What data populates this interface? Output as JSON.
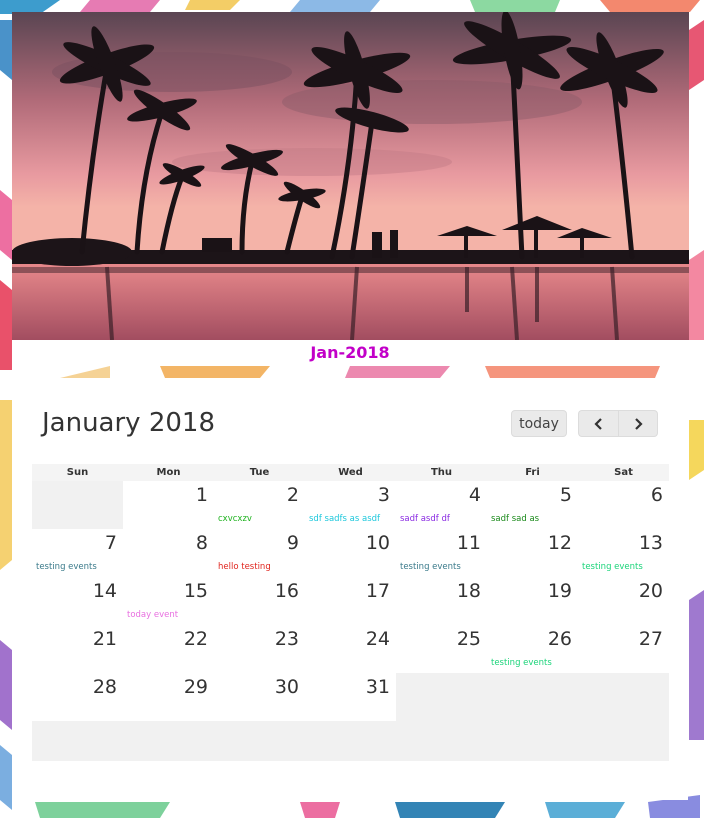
{
  "caption": "Jan-2018",
  "calendar": {
    "title": "January 2018",
    "today_label": "today",
    "prev_icon": "chevron-left-icon",
    "next_icon": "chevron-right-icon",
    "weekdays": [
      "Sun",
      "Mon",
      "Tue",
      "Wed",
      "Thu",
      "Fri",
      "Sat"
    ],
    "weeks": [
      [
        {
          "day": "",
          "other": true,
          "event": "",
          "color": ""
        },
        {
          "day": "1",
          "event": "",
          "color": ""
        },
        {
          "day": "2",
          "event": "cxvcxzv",
          "color": "#1fb31f"
        },
        {
          "day": "3",
          "event": "sdf sadfs as asdf",
          "color": "#1ec8dc"
        },
        {
          "day": "4",
          "event": "sadf asdf df",
          "color": "#8a2be2"
        },
        {
          "day": "5",
          "event": "sadf sad as",
          "color": "#1b8a1b"
        },
        {
          "day": "6",
          "event": "",
          "color": ""
        }
      ],
      [
        {
          "day": "7",
          "event": "testing events",
          "color": "#3a7a8a"
        },
        {
          "day": "8",
          "event": "",
          "color": ""
        },
        {
          "day": "9",
          "event": "hello testing",
          "color": "#e0261f"
        },
        {
          "day": "10",
          "event": "",
          "color": ""
        },
        {
          "day": "11",
          "event": "testing events",
          "color": "#3a7a8a"
        },
        {
          "day": "12",
          "event": "",
          "color": ""
        },
        {
          "day": "13",
          "event": "testing events",
          "color": "#1bd47a"
        }
      ],
      [
        {
          "day": "14",
          "event": "",
          "color": ""
        },
        {
          "day": "15",
          "event": "today event",
          "color": "#e86fe0"
        },
        {
          "day": "16",
          "event": "",
          "color": ""
        },
        {
          "day": "17",
          "event": "",
          "color": ""
        },
        {
          "day": "18",
          "event": "",
          "color": ""
        },
        {
          "day": "19",
          "event": "",
          "color": ""
        },
        {
          "day": "20",
          "event": "",
          "color": ""
        }
      ],
      [
        {
          "day": "21",
          "event": "",
          "color": ""
        },
        {
          "day": "22",
          "event": "",
          "color": ""
        },
        {
          "day": "23",
          "event": "",
          "color": ""
        },
        {
          "day": "24",
          "event": "",
          "color": ""
        },
        {
          "day": "25",
          "event": "",
          "color": ""
        },
        {
          "day": "26",
          "event": "testing events",
          "color": "#1bd47a"
        },
        {
          "day": "27",
          "event": "",
          "color": ""
        }
      ],
      [
        {
          "day": "28",
          "event": "",
          "color": ""
        },
        {
          "day": "29",
          "event": "",
          "color": ""
        },
        {
          "day": "30",
          "event": "",
          "color": ""
        },
        {
          "day": "31",
          "event": "",
          "color": ""
        },
        {
          "day": "",
          "other": true,
          "event": "",
          "color": ""
        },
        {
          "day": "",
          "other": true,
          "event": "",
          "color": ""
        },
        {
          "day": "",
          "other": true,
          "event": "",
          "color": ""
        }
      ],
      [
        {
          "day": "",
          "other": true,
          "event": "",
          "color": ""
        },
        {
          "day": "",
          "other": true,
          "event": "",
          "color": ""
        },
        {
          "day": "",
          "other": true,
          "event": "",
          "color": ""
        },
        {
          "day": "",
          "other": true,
          "event": "",
          "color": ""
        },
        {
          "day": "",
          "other": true,
          "event": "",
          "color": ""
        },
        {
          "day": "",
          "other": true,
          "event": "",
          "color": ""
        },
        {
          "day": "",
          "other": true,
          "event": "",
          "color": ""
        }
      ]
    ]
  }
}
